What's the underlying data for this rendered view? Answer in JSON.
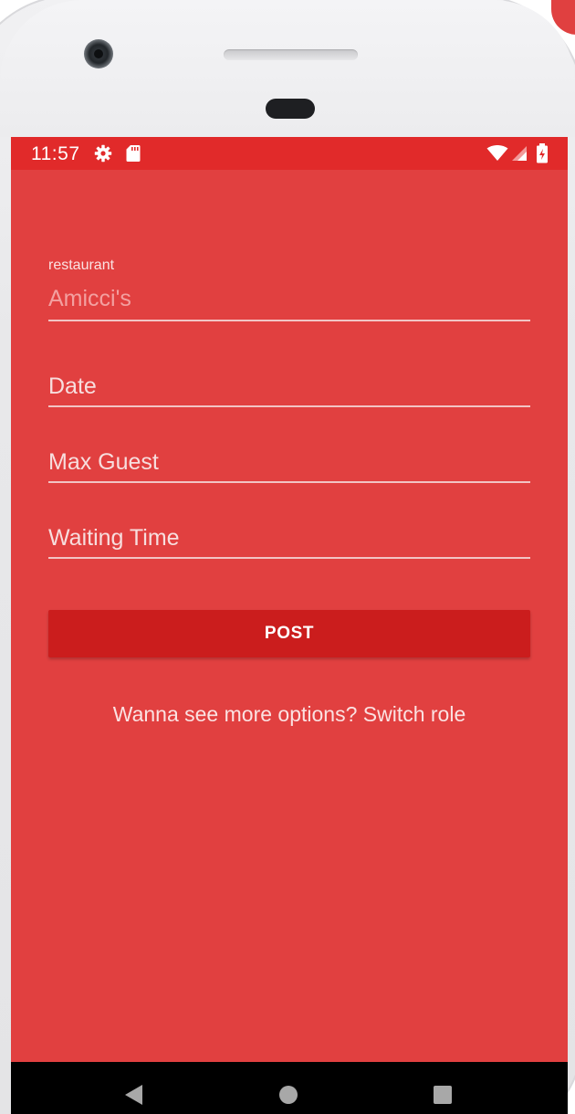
{
  "status_bar": {
    "time": "11:57",
    "icons": [
      "gear-icon",
      "sd-card-icon",
      "wifi-icon",
      "cell-signal-icon",
      "battery-charging-icon"
    ],
    "background_color": "#e12a2a"
  },
  "form": {
    "restaurant": {
      "label": "restaurant",
      "value": "Amicci's"
    },
    "date": {
      "placeholder": "Date"
    },
    "max_guest": {
      "placeholder": "Max Guest"
    },
    "waiting_time": {
      "placeholder": "Waiting Time"
    }
  },
  "actions": {
    "post_label": "POST",
    "switch_role_text": "Wanna see more options? Switch role"
  },
  "nav_bar": {
    "icons": [
      "back-icon",
      "home-icon",
      "recents-icon"
    ]
  },
  "colors": {
    "screen_background": "#e14040",
    "button_background": "#cb1d1d",
    "text_light": "#f7dede"
  }
}
